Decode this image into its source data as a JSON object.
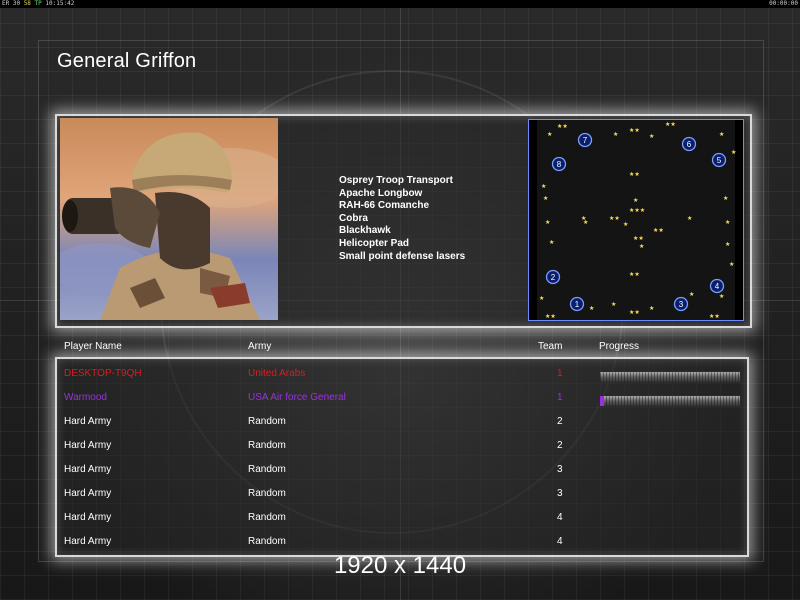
{
  "topbar": {
    "stats_left_a": "ER 30",
    "stats_left_b": "58",
    "stats_left_c": "TP",
    "clock_left": "10:15:42",
    "clock_right": "00:00:00"
  },
  "title": "General Griffon",
  "units": [
    "Osprey Troop Transport",
    "Apache Longbow",
    "RAH-66 Comanche",
    "Cobra",
    "Blackhawk",
    "Helicopter Pad",
    "Small point defense lasers"
  ],
  "minimap": {
    "start_positions": [
      "1",
      "2",
      "3",
      "4",
      "5",
      "6",
      "7",
      "8"
    ]
  },
  "players": {
    "headers": {
      "name": "Player Name",
      "army": "Army",
      "team": "Team",
      "progress": "Progress"
    },
    "rows": [
      {
        "name": "DESKTOP-T9QH",
        "army": "United Arabs",
        "team": "1",
        "color": "#d42020",
        "progress": 0.0
      },
      {
        "name": "Warmood",
        "army": "USA Air force General",
        "team": "1",
        "color": "#9b30e0",
        "progress": 0.03
      },
      {
        "name": "Hard Army",
        "army": "Random",
        "team": "2",
        "color": "#ffffff"
      },
      {
        "name": "Hard Army",
        "army": "Random",
        "team": "2",
        "color": "#ffffff"
      },
      {
        "name": "Hard Army",
        "army": "Random",
        "team": "3",
        "color": "#ffffff"
      },
      {
        "name": "Hard Army",
        "army": "Random",
        "team": "3",
        "color": "#ffffff"
      },
      {
        "name": "Hard Army",
        "army": "Random",
        "team": "4",
        "color": "#ffffff"
      },
      {
        "name": "Hard Army",
        "army": "Random",
        "team": "4",
        "color": "#ffffff"
      }
    ]
  },
  "resolution_label": "1920 x 1440"
}
